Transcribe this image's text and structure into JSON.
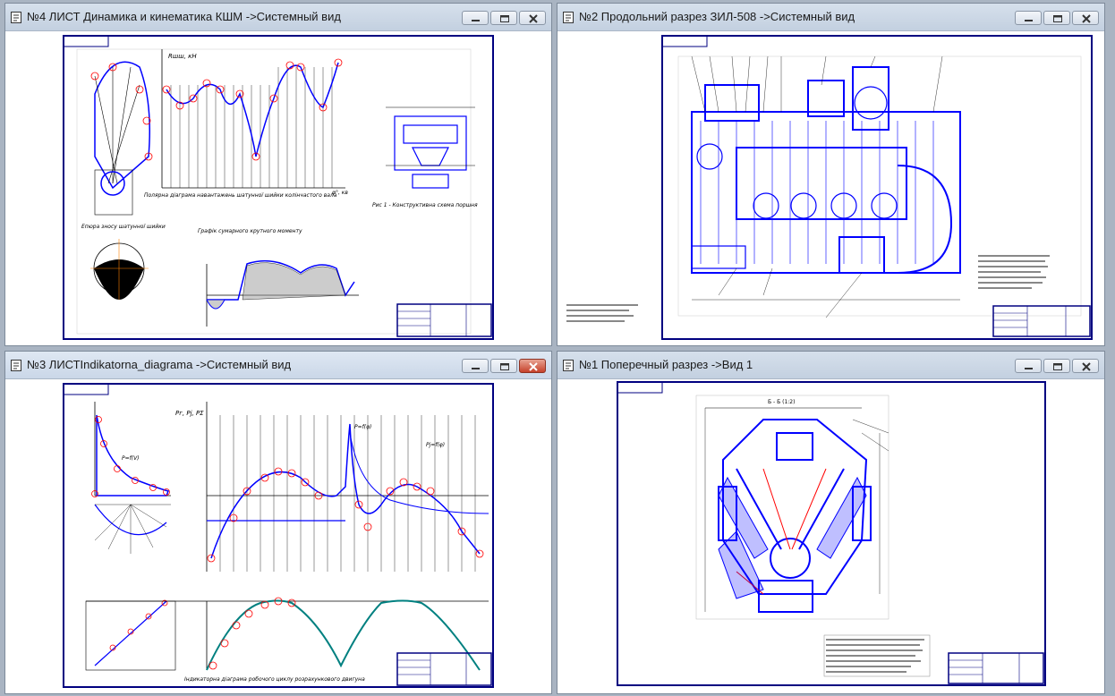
{
  "windows": [
    {
      "id": "w4",
      "title": "№4 ЛИСТ Динамика и кинематика КШМ ->Системный вид"
    },
    {
      "id": "w2",
      "title": "№2 Продольний разрез ЗИЛ-508 ->Системный вид"
    },
    {
      "id": "w3",
      "title": "№3 ЛИСТIndikatorna_diagrama ->Системный вид"
    },
    {
      "id": "w1",
      "title": "№1 Поперечный разрез  ->Вид 1"
    }
  ],
  "icons": {
    "doc": "document-icon",
    "min": "minimize-icon",
    "max": "maximize-icon",
    "close": "close-icon"
  },
  "colors": {
    "line": "#0000ff",
    "mark": "#ff0000",
    "frame": "#000080",
    "teal": "#008080"
  },
  "drawing4": {
    "caption_main": "Полярна діаграма навантажень шатунної шийки колінчастого вала",
    "caption_left": "Епюра зносу шатунної шийки",
    "caption_right": "Рис 1 - Конструктивна схема поршня",
    "caption_torque": "Графік сумарного крутного моменту",
    "axis_y": "Rшш, кН",
    "axis_x": "φ°, кв"
  },
  "drawing3": {
    "caption": "Індикаторна діаграма робочого циклу розрахункового двигуна",
    "label_p": "Pг, Pj, PΣ",
    "label_pv": "P=f(V)",
    "label_pphi": "P=f(φ)",
    "label_jf": "Pj=f(φ)"
  },
  "drawing1": {
    "section_label": "Б - Б (1:2)"
  }
}
